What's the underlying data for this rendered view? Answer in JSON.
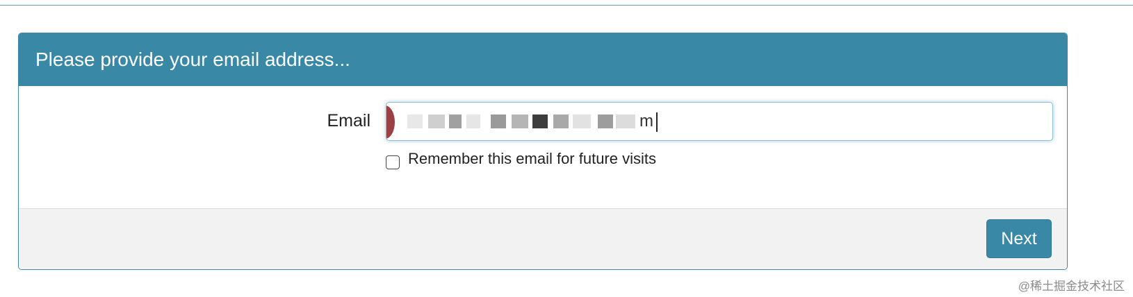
{
  "form": {
    "header_title": "Please provide your email address...",
    "email_label": "Email",
    "email_value_visible": "m",
    "remember_label": "Remember this email for future visits",
    "remember_checked": false,
    "next_label": "Next"
  },
  "watermark": "@稀土掘金技术社区",
  "colors": {
    "accent": "#3888a6",
    "footer_bg": "#f2f2f2",
    "autofill_badge": "#9b4044"
  }
}
